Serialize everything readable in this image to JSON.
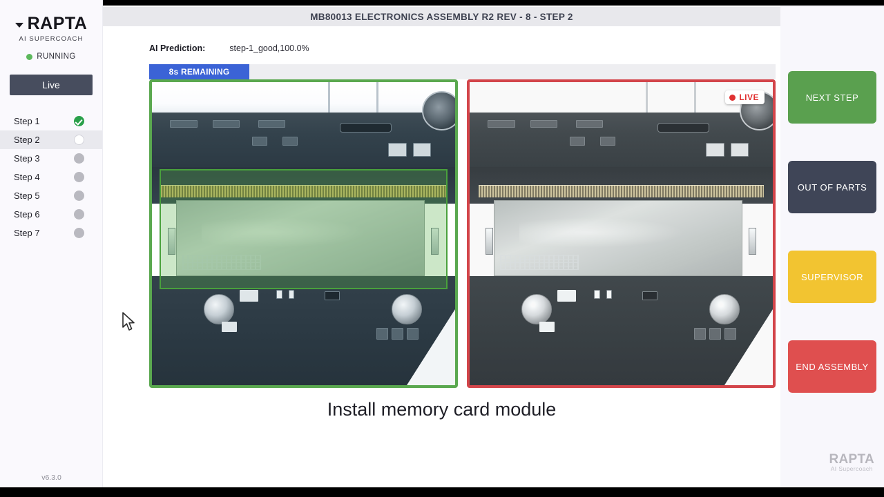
{
  "sidebar": {
    "brand": {
      "name": "RAPTA",
      "subtitle": "AI SUPERCOACH",
      "caret_icon": "chevron-down-icon"
    },
    "status": {
      "label": "RUNNING",
      "color": "#5cb85c"
    },
    "live_button": "Live",
    "steps": [
      {
        "label": "Step 1",
        "state": "done"
      },
      {
        "label": "Step 2",
        "state": "current"
      },
      {
        "label": "Step 3",
        "state": "pending"
      },
      {
        "label": "Step 4",
        "state": "pending"
      },
      {
        "label": "Step 5",
        "state": "pending"
      },
      {
        "label": "Step 6",
        "state": "pending"
      },
      {
        "label": "Step 7",
        "state": "pending"
      }
    ],
    "version": "v6.3.0"
  },
  "header": {
    "title": "MB80013 ELECTRONICS ASSEMBLY R2 REV - 8 - STEP 2"
  },
  "prediction": {
    "label": "AI Prediction:",
    "value": "step-1_good,100.0%"
  },
  "progress": {
    "text": "8s REMAINING",
    "percent": 16,
    "fill_color": "#3b63d6",
    "track_color": "#eeeef1"
  },
  "panels": {
    "reference": {
      "border_color": "#5aa84f",
      "roi_label": "memory-module-region"
    },
    "live": {
      "border_color": "#d3454a",
      "badge_text": "LIVE",
      "badge_dot_color": "#e03131"
    }
  },
  "caption": "Install memory card module",
  "actions": [
    {
      "label": "NEXT STEP",
      "color": "#5aa04f"
    },
    {
      "label": "OUT OF PARTS",
      "color": "#3f4557"
    },
    {
      "label": "SUPERVISOR",
      "color": "#f2c431"
    },
    {
      "label": "END ASSEMBLY",
      "color": "#df4f4f"
    }
  ],
  "watermark": {
    "name": "RAPTA",
    "subtitle": "AI Supercoach"
  }
}
